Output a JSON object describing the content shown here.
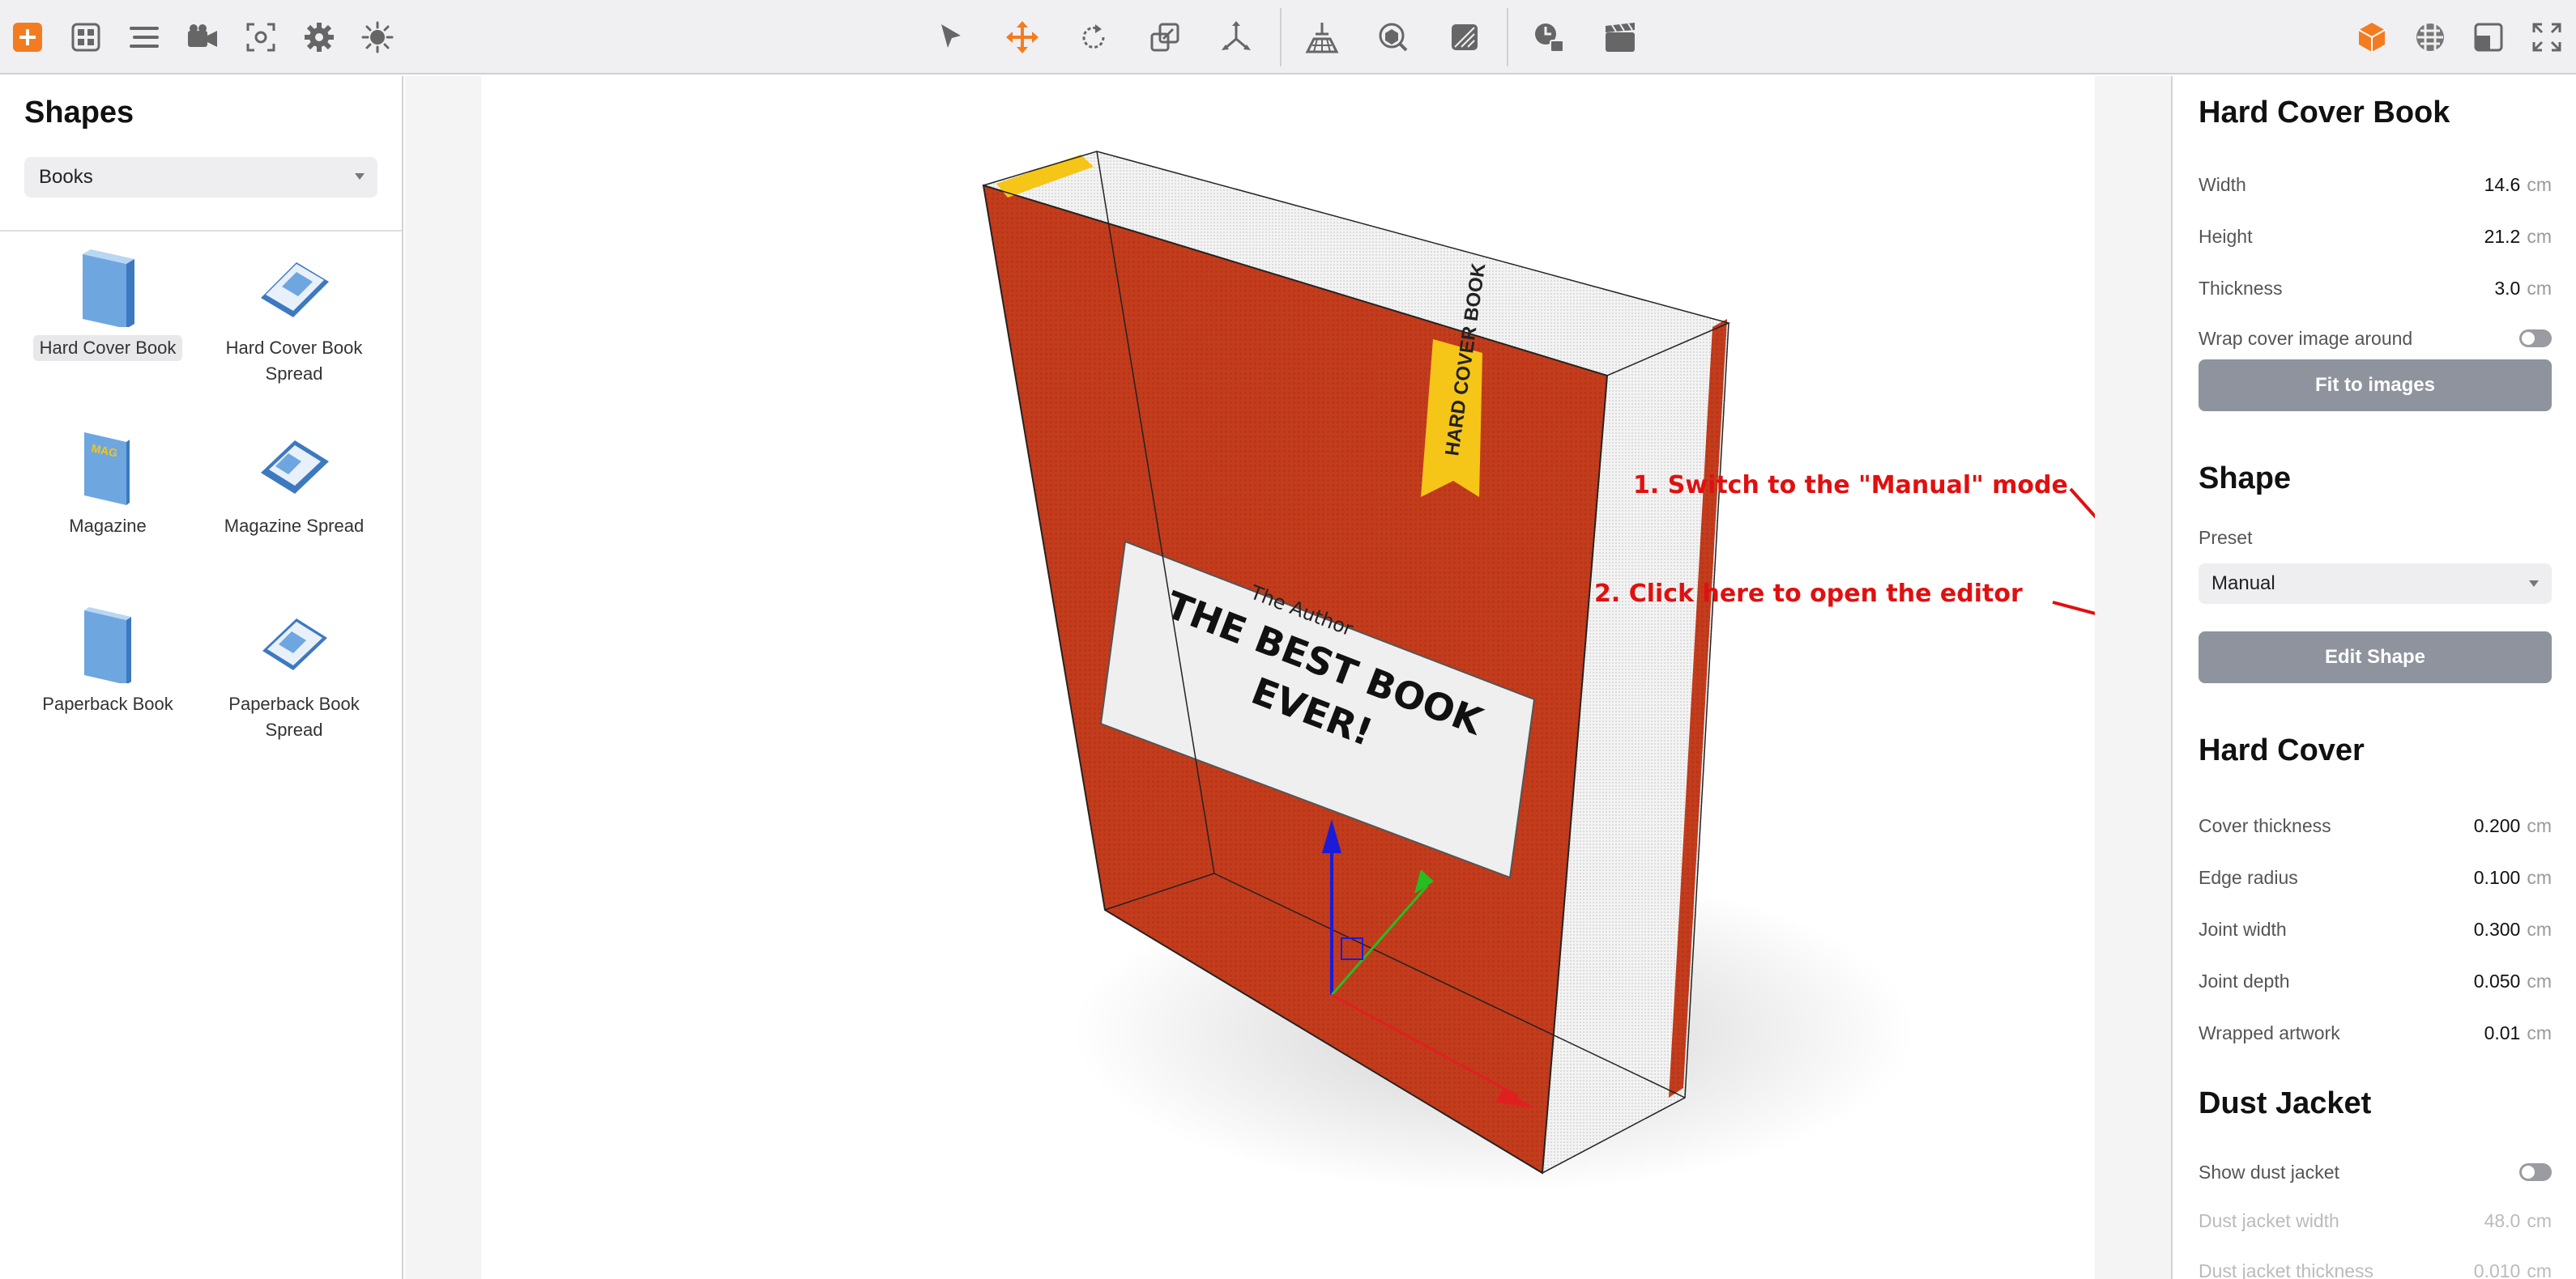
{
  "toolbar": {
    "left_icons": [
      "add-icon",
      "grid-icon",
      "list-icon",
      "camera-icon",
      "focus-icon",
      "gear-icon",
      "light-icon"
    ],
    "center_icons": [
      "pointer-icon",
      "move-icon",
      "rotate-icon",
      "scale-icon",
      "axes-icon",
      "floor-icon",
      "material-icon",
      "texture-icon",
      "animation-icon",
      "clapper-icon"
    ],
    "right_icons": [
      "cube-icon",
      "sphere-icon",
      "layout-icon",
      "fullscreen-icon"
    ],
    "accent_color": "#f47c20"
  },
  "left_panel": {
    "title": "Shapes",
    "category": "Books",
    "items": [
      {
        "label": "Hard Cover Book",
        "selected": true,
        "icon": "hard-cover-book-icon"
      },
      {
        "label": "Hard Cover Book Spread",
        "icon": "hard-cover-book-spread-icon"
      },
      {
        "label": "Magazine",
        "icon": "magazine-icon"
      },
      {
        "label": "Magazine Spread",
        "icon": "magazine-spread-icon"
      },
      {
        "label": "Paperback Book",
        "icon": "paperback-book-icon"
      },
      {
        "label": "Paperback Book Spread",
        "icon": "paperback-book-spread-icon"
      }
    ]
  },
  "viewport": {
    "book": {
      "author": "The Author",
      "title_line1": "THE BEST BOOK",
      "title_line2": "EVER!",
      "bookmark": "HARD COVER BOOK",
      "cover_color": "#c0391b",
      "ribbon_color": "#f5c518"
    },
    "annotations": {
      "step1": "1. Switch to the \"Manual\" mode",
      "step2": "2. Click here to open the editor"
    }
  },
  "right_panel": {
    "object": {
      "title": "Hard Cover Book",
      "width_label": "Width",
      "width_value": "14.6",
      "width_unit": "cm",
      "height_label": "Height",
      "height_value": "21.2",
      "height_unit": "cm",
      "thickness_label": "Thickness",
      "thickness_value": "3.0",
      "thickness_unit": "cm",
      "wrap_label": "Wrap cover image around",
      "fit_button": "Fit to images"
    },
    "shape": {
      "title": "Shape",
      "preset_label": "Preset",
      "preset_value": "Manual",
      "edit_button": "Edit Shape"
    },
    "hard_cover": {
      "title": "Hard Cover",
      "cover_thickness_label": "Cover thickness",
      "cover_thickness_value": "0.200",
      "cover_thickness_unit": "cm",
      "edge_radius_label": "Edge radius",
      "edge_radius_value": "0.100",
      "edge_radius_unit": "cm",
      "joint_width_label": "Joint width",
      "joint_width_value": "0.300",
      "joint_width_unit": "cm",
      "joint_depth_label": "Joint depth",
      "joint_depth_value": "0.050",
      "joint_depth_unit": "cm",
      "wrapped_artwork_label": "Wrapped artwork",
      "wrapped_artwork_value": "0.01",
      "wrapped_artwork_unit": "cm"
    },
    "dust_jacket": {
      "title": "Dust Jacket",
      "show_label": "Show dust jacket",
      "width_label": "Dust jacket width",
      "width_value": "48.0",
      "width_unit": "cm",
      "thickness_label": "Dust jacket thickness",
      "thickness_value": "0.010",
      "thickness_unit": "cm"
    }
  }
}
